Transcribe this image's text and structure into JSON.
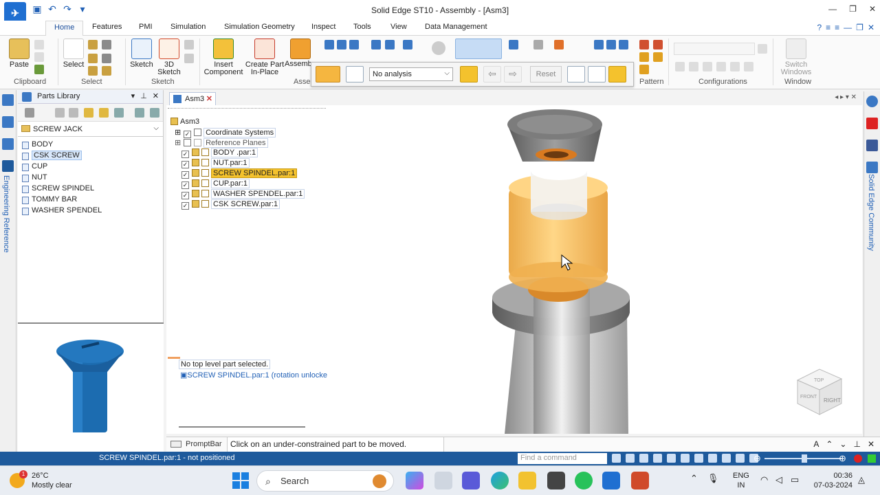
{
  "window": {
    "title": "Solid Edge ST10 - Assembly - [Asm3]"
  },
  "ribbon_tabs": [
    "Home",
    "Features",
    "PMI",
    "Simulation",
    "Simulation Geometry",
    "Inspect",
    "Tools",
    "View",
    "Data Management"
  ],
  "ribbon": {
    "paste": "Paste",
    "select": "Select",
    "sketch": "Sketch",
    "sketch3d_1": "3D",
    "sketch3d_2": "Sketch",
    "insert_1": "Insert",
    "insert_2": "Component",
    "create_1": "Create Part",
    "create_2": "In-Place",
    "assemble": "Assemb",
    "switch_1": "Switch",
    "switch_2": "Windows",
    "groups": {
      "clipboard": "Clipboard",
      "select": "Select",
      "sketch": "Sketch",
      "asse": "Asse",
      "pattern": "Pattern",
      "configurations": "Configurations",
      "window": "Window"
    }
  },
  "analysis_bar": {
    "analysis_value": "No analysis",
    "reset": "Reset"
  },
  "left_strip": {
    "label": "Engineering Reference"
  },
  "parts_library": {
    "title": "Parts Library",
    "folder": "SCREW JACK",
    "items": [
      "BODY",
      "CSK SCREW",
      "CUP",
      "NUT",
      "SCREW SPINDEL",
      "TOMMY BAR",
      "WASHER SPENDEL"
    ],
    "selected": "CSK SCREW"
  },
  "doc_tab": {
    "label": "Asm3"
  },
  "tree": {
    "root": "Asm3",
    "coord": "Coordinate Systems",
    "ref": "Reference Planes",
    "parts": [
      "BODY .par:1",
      "NUT.par:1",
      "SCREW SPINDEL.par:1",
      "CUP.par:1",
      "WASHER SPENDEL.par:1",
      "CSK SCREW.par:1"
    ]
  },
  "viewport_msgs": {
    "line1": "No top level part selected.",
    "line2": "SCREW SPINDEL.par:1  (rotation unlocke"
  },
  "view_cube": {
    "top": "TOP",
    "front": "FRONT",
    "right": "RIGHT"
  },
  "right_strip": {
    "label": "Solid Edge Community"
  },
  "promptbar": {
    "label": "PromptBar",
    "message": "Click on an under-constrained part to be moved."
  },
  "statusbar": {
    "message": "SCREW SPINDEL.par:1 - not positioned",
    "find_placeholder": "Find a command"
  },
  "taskbar": {
    "temp": "26°C",
    "weather": "Mostly clear",
    "badge": "1",
    "search": "Search",
    "lang1": "ENG",
    "lang2": "IN",
    "time": "00:36",
    "date": "07-03-2024"
  },
  "colors": {
    "accent": "#1e5a9c",
    "highlight": "#f4c22d",
    "preview_blue": "#1c6cb0"
  }
}
